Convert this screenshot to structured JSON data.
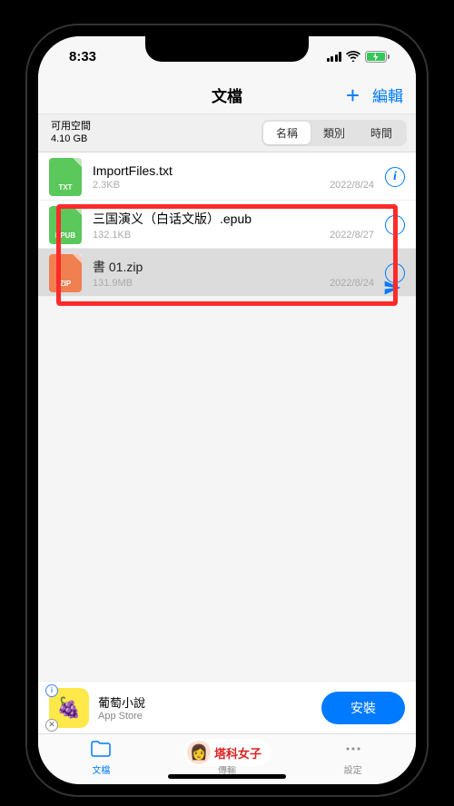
{
  "status": {
    "time": "8:33"
  },
  "nav": {
    "title": "文檔",
    "add_label": "+",
    "edit_label": "編輯"
  },
  "toolbar": {
    "space_label": "可用空間",
    "space_value": "4.10 GB",
    "sort": {
      "name": "名稱",
      "type": "類別",
      "time": "時間"
    }
  },
  "files": [
    {
      "name": "ImportFiles.txt",
      "size": "2.3KB",
      "date": "2022/8/24",
      "ext": "TXT",
      "icon": "txt",
      "highlighted": false
    },
    {
      "name": "三国演义（白话文版）.epub",
      "size": "132.1KB",
      "date": "2022/8/27",
      "ext": "EPUB",
      "icon": "epub",
      "highlighted": false
    },
    {
      "name": "書 01.zip",
      "size": "131.9MB",
      "date": "2022/8/24",
      "ext": "ZIP",
      "icon": "zip",
      "highlighted": true
    }
  ],
  "ad": {
    "title": "葡萄小說",
    "subtitle": "App Store",
    "cta": "安裝",
    "icon_emoji": "🍇"
  },
  "tabs": {
    "docs": "文檔",
    "transfer": "傳輸",
    "settings": "設定"
  },
  "watermark": {
    "text": "塔科女子"
  }
}
